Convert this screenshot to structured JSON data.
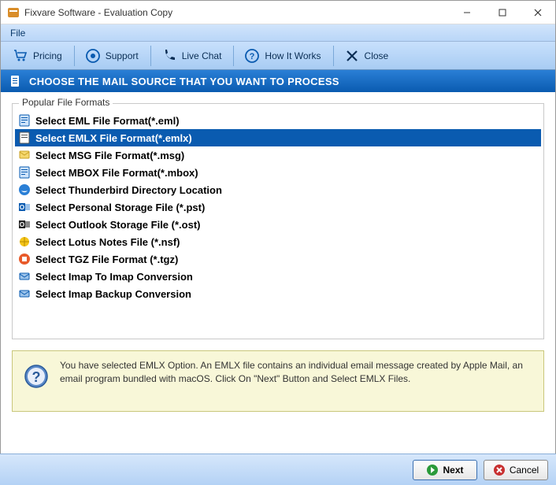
{
  "window": {
    "title": "Fixvare Software - Evaluation Copy"
  },
  "menu": {
    "file": "File"
  },
  "toolbar": {
    "pricing": "Pricing",
    "support": "Support",
    "live_chat": "Live Chat",
    "how_it_works": "How It Works",
    "close": "Close"
  },
  "header": {
    "title": "CHOOSE THE MAIL SOURCE THAT YOU WANT TO PROCESS"
  },
  "group": {
    "legend": "Popular File Formats"
  },
  "formats": [
    {
      "label": "Select EML File Format(*.eml)",
      "icon": "file-blue",
      "selected": false
    },
    {
      "label": "Select EMLX File Format(*.emlx)",
      "icon": "file-white",
      "selected": true
    },
    {
      "label": "Select MSG File Format(*.msg)",
      "icon": "file-yellow",
      "selected": false
    },
    {
      "label": "Select MBOX File Format(*.mbox)",
      "icon": "file-blue",
      "selected": false
    },
    {
      "label": "Select Thunderbird Directory Location",
      "icon": "thunderbird",
      "selected": false
    },
    {
      "label": "Select Personal Storage File (*.pst)",
      "icon": "outlook",
      "selected": false
    },
    {
      "label": "Select Outlook Storage File (*.ost)",
      "icon": "outlook-dark",
      "selected": false
    },
    {
      "label": "Select Lotus Notes File (*.nsf)",
      "icon": "lotus",
      "selected": false
    },
    {
      "label": "Select TGZ File Format (*.tgz)",
      "icon": "tgz",
      "selected": false
    },
    {
      "label": "Select Imap To Imap Conversion",
      "icon": "imap",
      "selected": false
    },
    {
      "label": "Select Imap Backup Conversion",
      "icon": "imap",
      "selected": false
    }
  ],
  "info": {
    "text": "You have selected EMLX Option. An EMLX file contains an individual email message created by Apple Mail, an email program bundled with macOS. Click On \"Next\" Button and Select EMLX Files."
  },
  "footer": {
    "next": "Next",
    "cancel": "Cancel"
  }
}
